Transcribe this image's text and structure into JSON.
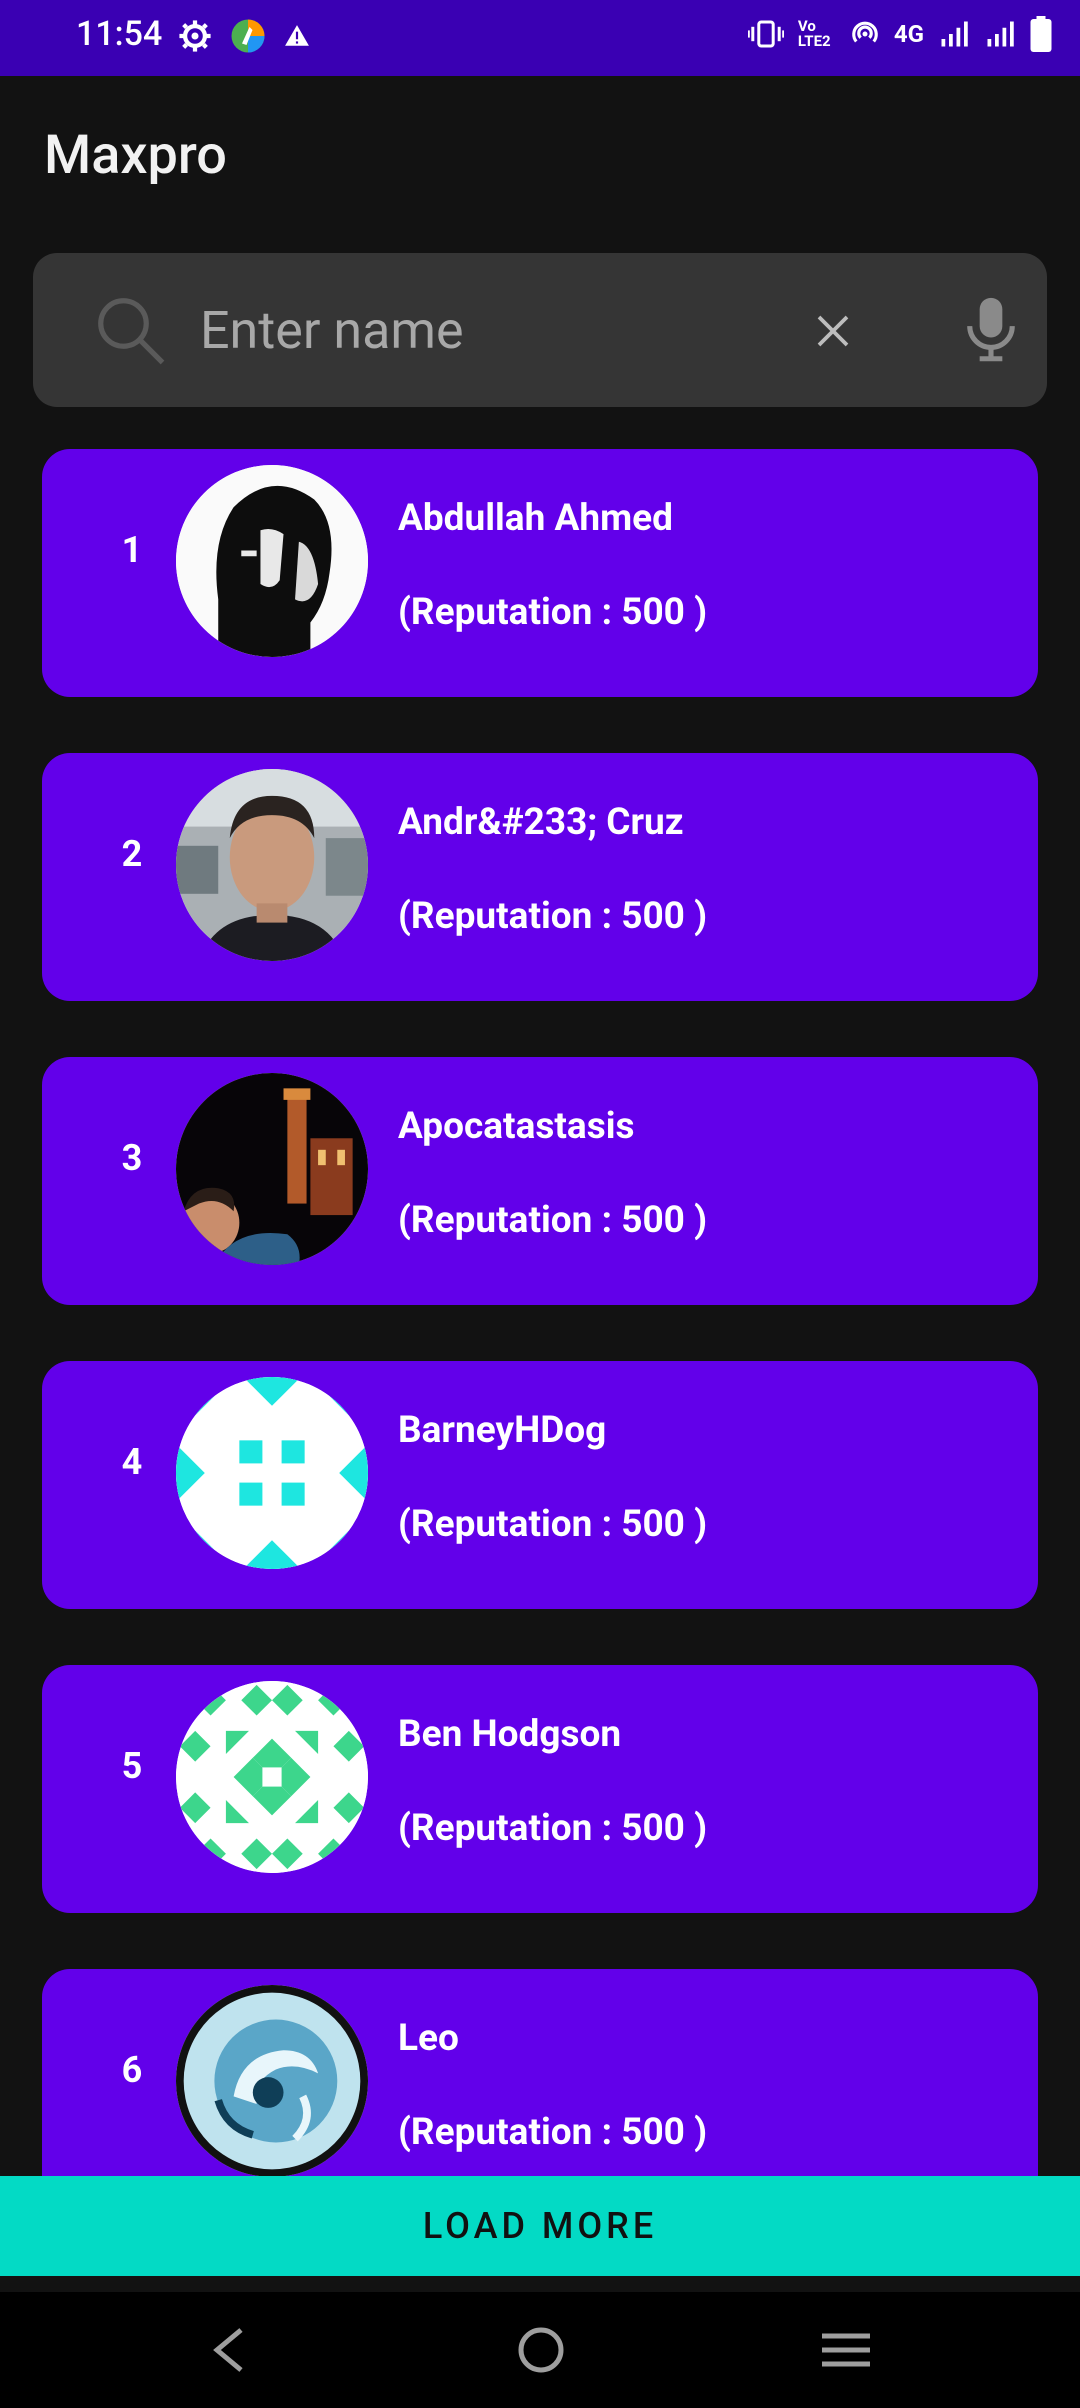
{
  "status_bar": {
    "time": "11:54",
    "left_icons": [
      "gear-icon",
      "app-logo-icon",
      "alert-icon"
    ],
    "right_icons": [
      "vibrate-icon",
      "volte-icon",
      "hotspot-icon",
      "network-4g-icon",
      "signal-icon",
      "signal-icon",
      "battery-icon"
    ],
    "volte_text": "Vo LTE2",
    "network_text": "4G"
  },
  "app": {
    "title": "Maxpro"
  },
  "search": {
    "placeholder": "Enter name",
    "value": ""
  },
  "users": [
    {
      "rank": "1",
      "name": "Abdullah Ahmed",
      "reputation": "(Reputation : 500 )"
    },
    {
      "rank": "2",
      "name": "Andr&#233; Cruz",
      "reputation": "(Reputation : 500 )"
    },
    {
      "rank": "3",
      "name": "Apocatastasis",
      "reputation": "(Reputation : 500 )"
    },
    {
      "rank": "4",
      "name": "BarneyHDog",
      "reputation": "(Reputation : 500 )"
    },
    {
      "rank": "5",
      "name": "Ben Hodgson",
      "reputation": "(Reputation : 500 )"
    },
    {
      "rank": "6",
      "name": "Leo",
      "reputation": "(Reputation : 500 )"
    }
  ],
  "load_more_label": "LOAD MORE",
  "colors": {
    "status_bar": "#3a00b3",
    "background": "#121212",
    "card": "#6200ea",
    "search_bg": "#353535",
    "load_more": "#03dac5"
  }
}
